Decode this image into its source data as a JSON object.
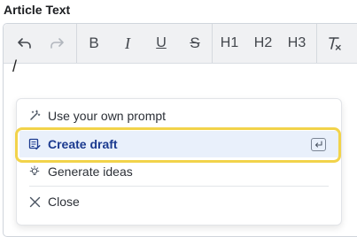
{
  "field": {
    "label": "Article Text"
  },
  "toolbar": {
    "undo_icon": "undo-icon",
    "redo_icon": "redo-icon",
    "bold": "B",
    "italic": "I",
    "underline": "U",
    "strike": "S",
    "h1": "H1",
    "h2": "H2",
    "h3": "H3",
    "clear_format_icon": "clear-format-icon"
  },
  "editor": {
    "content": "/"
  },
  "menu": {
    "items": [
      {
        "label": "Use your own prompt",
        "icon": "magic-wand-icon"
      },
      {
        "label": "Create draft",
        "icon": "draft-icon",
        "shortcut_icon": "enter-key-icon",
        "selected": true
      },
      {
        "label": "Generate ideas",
        "icon": "lightbulb-icon"
      },
      {
        "label": "Close",
        "icon": "close-icon"
      }
    ]
  },
  "colors": {
    "highlight_border": "#f2d34a",
    "selected_bg": "#e9f0fb",
    "selected_text": "#1b3a8f"
  }
}
